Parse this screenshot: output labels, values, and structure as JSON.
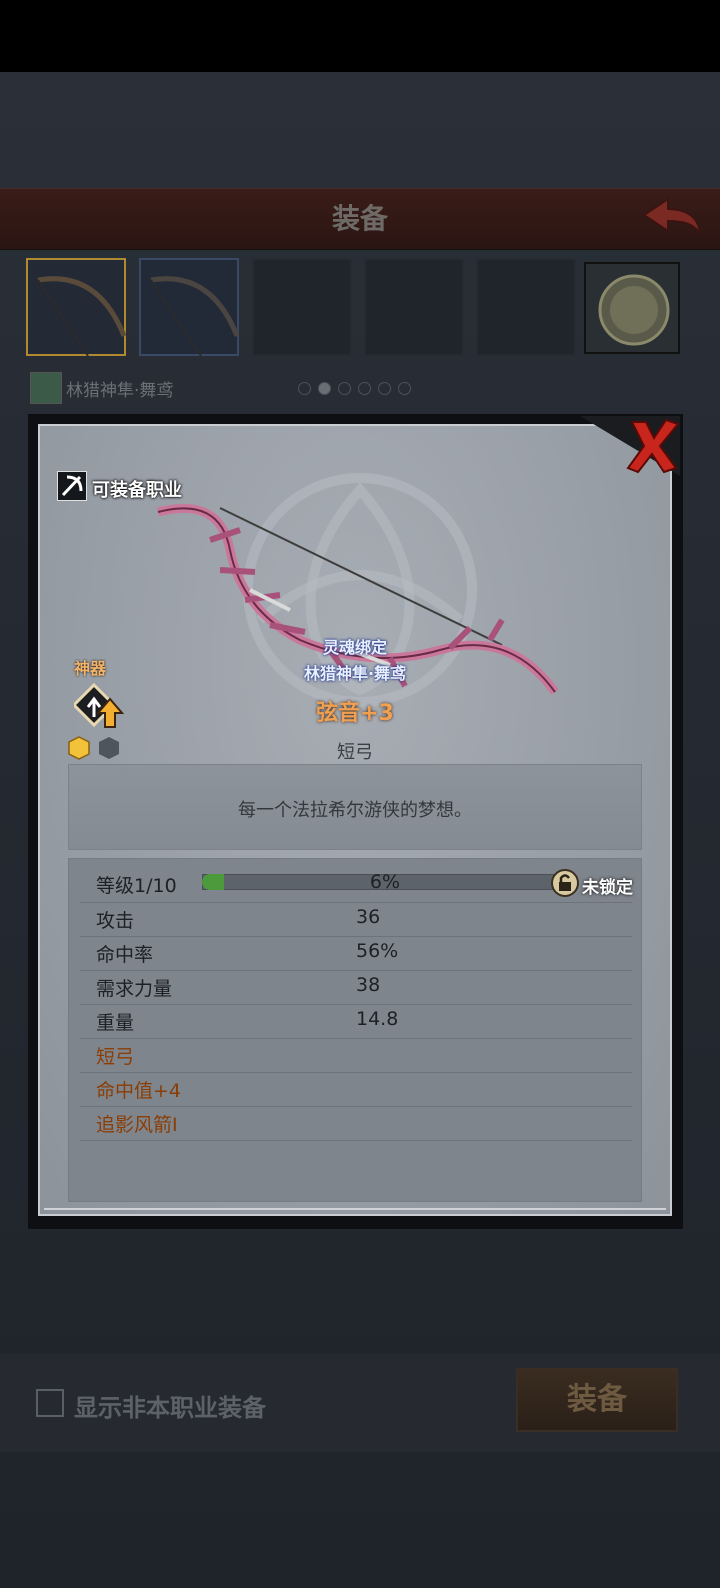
{
  "header": {
    "title": "装备"
  },
  "hero": {
    "name": "林猎神隼·舞鸢"
  },
  "item": {
    "equip_class_label": "可装备职业",
    "soulbind_label": "灵魂绑定",
    "soulbind_owner": "林猎神隼·舞鸢",
    "artifact_label": "神器",
    "name": "弦音+3",
    "type": "短弓",
    "description": "每一个法拉希尔游侠的梦想。"
  },
  "stats": {
    "level_label": "等级1/10",
    "level_progress_pct": "6%",
    "level_progress": 0.06,
    "lock_label": "未锁定",
    "rows": [
      {
        "label": "攻击",
        "value": "36"
      },
      {
        "label": "命中率",
        "value": "56%"
      },
      {
        "label": "需求力量",
        "value": "38"
      },
      {
        "label": "重量",
        "value": "14.8"
      }
    ],
    "extras": [
      "短弓",
      "命中值+4",
      "追影风箭I"
    ]
  },
  "footer": {
    "show_other_class_label": "显示非本职业装备",
    "equip_button": "装备"
  },
  "colors": {
    "item_name": "#f0a050",
    "extra_text": "#8a3d05",
    "progress": "#4d9a3c"
  }
}
